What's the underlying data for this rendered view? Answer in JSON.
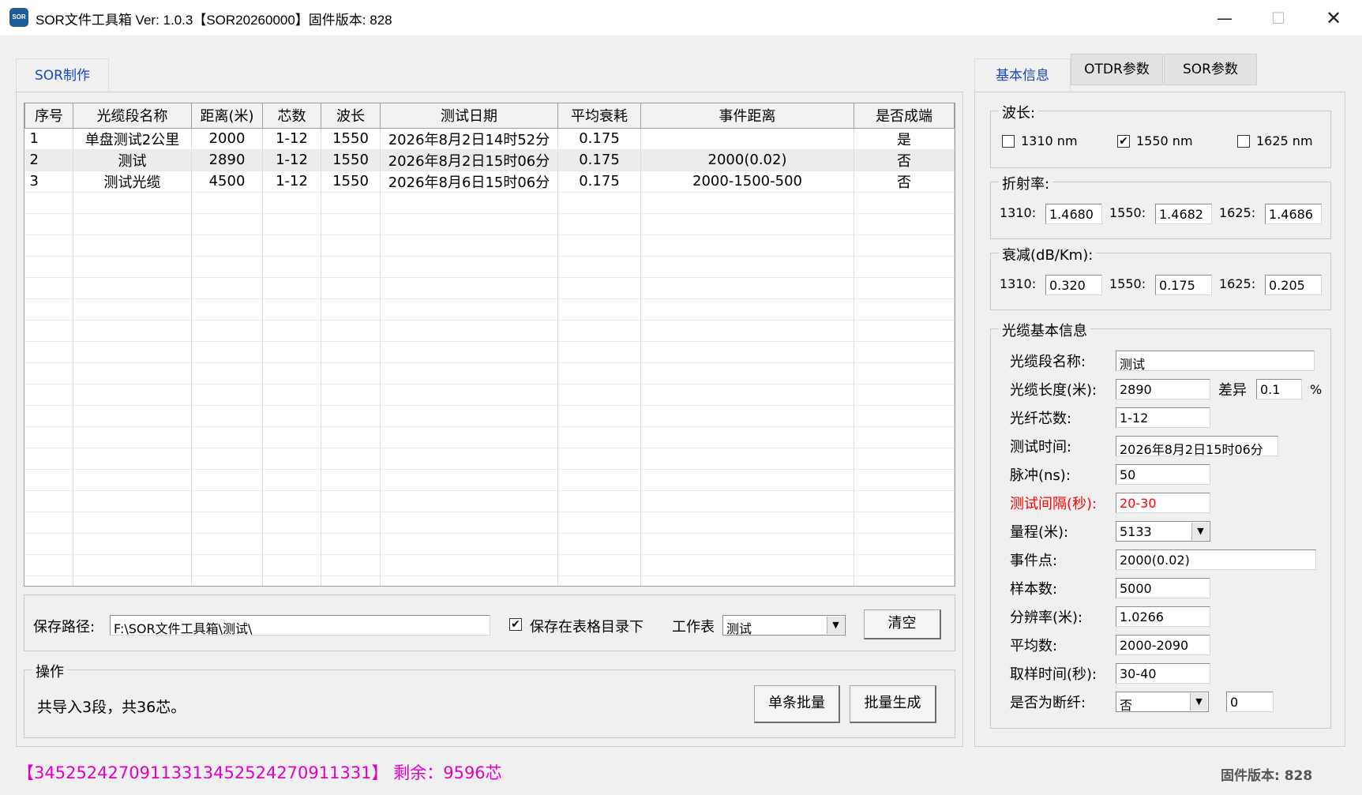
{
  "window": {
    "title": "SOR文件工具箱  Ver: 1.0.3【SOR20260000】固件版本: 828",
    "icon_label": "SOR",
    "minimize_glyph": "—",
    "maximize_glyph": "☐",
    "close_glyph": "✕"
  },
  "left_tabs": [
    {
      "label": "SOR制作"
    }
  ],
  "table": {
    "headers": [
      "序号",
      "光缆段名称",
      "距离(米)",
      "芯数",
      "波长",
      "测试日期",
      "平均衰耗",
      "事件距离",
      "是否成端"
    ],
    "rows": [
      [
        "1",
        "单盘测试2公里",
        "2000",
        "1-12",
        "1550",
        "2026年8月2日14时52分",
        "0.175",
        "",
        "是"
      ],
      [
        "2",
        "测试",
        "2890",
        "1-12",
        "1550",
        "2026年8月2日15时06分",
        "0.175",
        "2000(0.02)",
        "否"
      ],
      [
        "3",
        "测试光缆",
        "4500",
        "1-12",
        "1550",
        "2026年8月6日15时06分",
        "0.175",
        "2000-1500-500",
        "否"
      ]
    ],
    "selected_row": 1
  },
  "save": {
    "path_label": "保存路径:",
    "path_value": "F:\\SOR文件工具箱\\测试\\",
    "checkbox_label": "保存在表格目录下",
    "checkbox_checked": "✔",
    "sheet_label": "工作表",
    "sheet_value": "测试",
    "clear_button": "清空"
  },
  "operation": {
    "legend": "操作",
    "message": "共导入3段，共36芯。",
    "single_button": "单条批量",
    "batch_button": "批量生成"
  },
  "status": {
    "license_text": "【34525242709113313452524270911331】 剩余：9596芯",
    "firmware_text": "固件版本: 828",
    "license_color": "#e000c8"
  },
  "right_tabs": [
    {
      "label": "基本信息"
    },
    {
      "label": "OTDR参数"
    },
    {
      "label": "SOR参数"
    }
  ],
  "wavelength": {
    "legend": "波长:",
    "options": [
      {
        "label": "1310 nm",
        "checked": false
      },
      {
        "label": "1550 nm",
        "checked": true
      },
      {
        "label": "1625 nm",
        "checked": false
      }
    ],
    "check_glyph": "✔"
  },
  "refraction": {
    "legend": "折射率:",
    "label_1310": "1310:",
    "label_1550": "1550:",
    "label_1625": "1625:",
    "value_1310": "1.4680",
    "value_1550": "1.4682",
    "value_1625": "1.4686"
  },
  "attenuation": {
    "legend": "衰减(dB/Km):",
    "label_1310": "1310:",
    "label_1550": "1550:",
    "label_1625": "1625:",
    "value_1310": "0.320",
    "value_1550": "0.175",
    "value_1625": "0.205"
  },
  "cable_info": {
    "legend": "光缆基本信息",
    "name_label": "光缆段名称:",
    "name_value": "测试",
    "length_label": "光缆长度(米):",
    "length_value": "2890",
    "diff_label": "差异",
    "diff_value": "0.1",
    "diff_unit": "%",
    "cores_label": "光纤芯数:",
    "cores_value": "1-12",
    "time_label": "测试时间:",
    "time_value": "2026年8月2日15时06分",
    "pulse_label": "脉冲(ns):",
    "pulse_value": "50",
    "interval_label": "测试间隔(秒):",
    "interval_value": "20-30",
    "interval_color": "#ff0000",
    "range_label": "量程(米):",
    "range_value": "5133",
    "event_label": "事件点:",
    "event_value": "2000(0.02)",
    "samples_label": "样本数:",
    "samples_value": "5000",
    "resolution_label": "分辨率(米):",
    "resolution_value": "1.0266",
    "average_label": "平均数:",
    "average_value": "2000-2090",
    "sampling_label": "取样时间(秒):",
    "sampling_value": "30-40",
    "broken_label": "是否为断纤:",
    "broken_value": "否",
    "broken_extra_value": "0"
  }
}
